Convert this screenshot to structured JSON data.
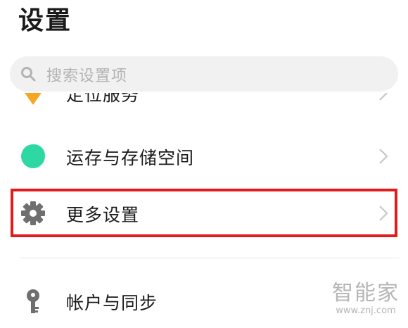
{
  "header": {
    "title": "设置"
  },
  "search": {
    "placeholder": "搜索设置项",
    "icon": "search-icon"
  },
  "settings": {
    "items": [
      {
        "label": "定位服务",
        "icon": "location-icon",
        "icon_color": "#f5a623"
      },
      {
        "label": "运存与存储空间",
        "icon": "pie-chart-icon",
        "icon_color": "#2ed8a3"
      },
      {
        "label": "更多设置",
        "icon": "gear-icon",
        "icon_color": "#6f6f6f",
        "highlighted": true
      },
      {
        "label": "帐户与同步",
        "icon": "key-icon",
        "icon_color": "#6f6f6f"
      }
    ]
  },
  "watermark": {
    "text": "智能家",
    "url": "www.znj.com"
  },
  "colors": {
    "highlight_border": "#e21b1b",
    "chevron": "#c8c8c8",
    "search_bg": "#f1f1f1"
  }
}
